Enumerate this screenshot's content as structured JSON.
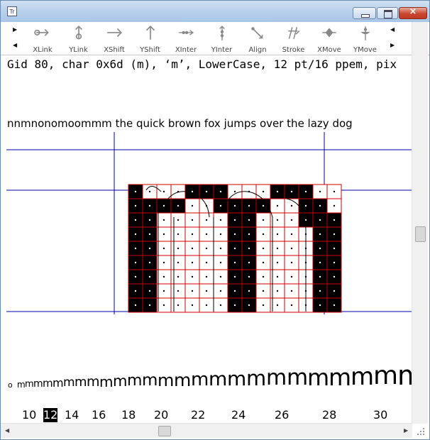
{
  "window": {
    "icon": "Tr",
    "close_glyph": "×"
  },
  "toolbar": {
    "tools": [
      {
        "label": "XLink",
        "icon": "xlink-icon"
      },
      {
        "label": "YLink",
        "icon": "ylink-icon"
      },
      {
        "label": "XShift",
        "icon": "xshift-icon"
      },
      {
        "label": "YShift",
        "icon": "yshift-icon"
      },
      {
        "label": "XInter",
        "icon": "xinter-icon"
      },
      {
        "label": "YInter",
        "icon": "yinter-icon"
      },
      {
        "label": "Align",
        "icon": "align-icon"
      },
      {
        "label": "Stroke",
        "icon": "stroke-icon"
      },
      {
        "label": "XMove",
        "icon": "xmove-icon"
      },
      {
        "label": "YMove",
        "icon": "ymove-icon"
      }
    ]
  },
  "status": "Gid 80, char 0x6d (m), ‘m’, LowerCase, 12 pt/16 ppem, pix",
  "sample_text": "nnmnonomoommm the quick brown fox jumps over the lazy dog",
  "glyph": {
    "char": "m",
    "colors": {
      "grid": "#cc0000",
      "guides": "#0000aa",
      "on": "#000000",
      "off": "#ffffff"
    },
    "rows": [
      "X...XXX...XXX..",
      "XXXX..XXXX..XX.",
      "XX.....XX...XXX",
      "XX.....XX....XX",
      "XX.....XX....XX",
      "XX.....XX....XX",
      "XX.....XX....XX",
      "XX.....XX....XX",
      "XX.....XX....XX"
    ]
  },
  "waterfall": {
    "char": "m",
    "circle_glyph": "o"
  },
  "sizes": {
    "selected": "12",
    "labels": [
      "10",
      "12",
      "14",
      "16",
      "18",
      "20",
      "22",
      "24",
      "26",
      "28",
      "30"
    ]
  }
}
